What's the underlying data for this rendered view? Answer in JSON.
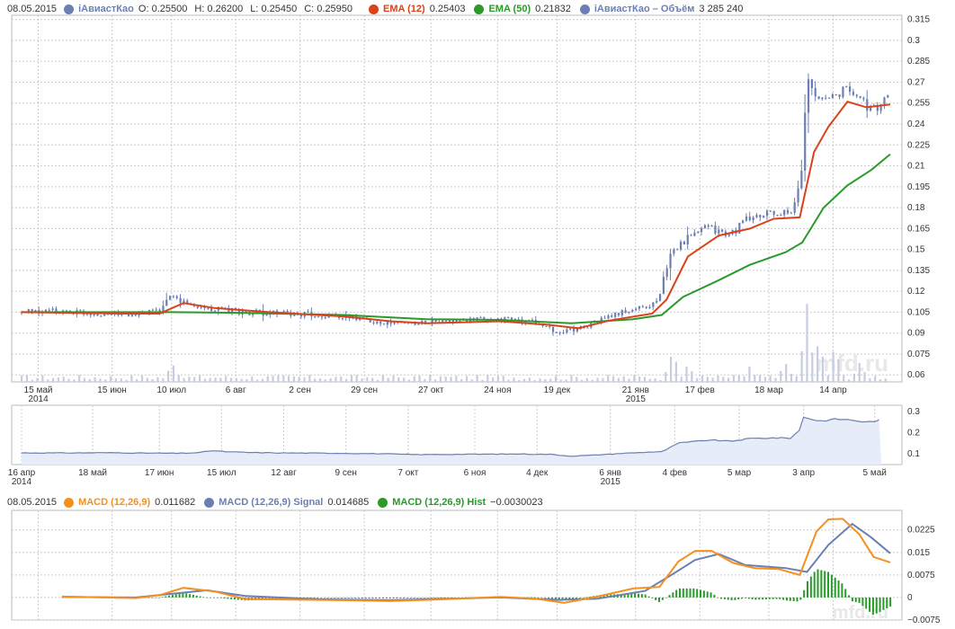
{
  "legend_main": {
    "date": "08.05.2015",
    "ticker": "iАвиастКао",
    "o_label": "O:",
    "o_value": "0.25500",
    "h_label": "H:",
    "h_value": "0.26200",
    "l_label": "L:",
    "l_value": "0.25450",
    "c_label": "C:",
    "c_value": "0.25950",
    "ema12_name": "EMA (12)",
    "ema12_value": "0.25403",
    "ema50_name": "EMA (50)",
    "ema50_value": "0.21832",
    "volume_name": "iАвиастКао – Объём",
    "volume_value": "3 285 240"
  },
  "legend_macd": {
    "date": "08.05.2015",
    "macd_name": "MACD (12,26,9)",
    "macd_value": "0.011682",
    "signal_name": "MACD (12,26,9) Signal",
    "signal_value": "0.014685",
    "hist_name": "MACD (12,26,9) Hist",
    "hist_value": "−0.0030023"
  },
  "colors": {
    "candle": "#6b7fb3",
    "ema12": "#d9431c",
    "ema50": "#2a9a2a",
    "volume": "#c7cde0",
    "macd": "#f5901e",
    "signal": "#6b7fb3",
    "hist": "#2a9a2a",
    "nav_line": "#6b7fb3",
    "nav_fill": "#e6edf8",
    "grid": "#cccccc",
    "watermark": "#e8e8e8"
  },
  "watermark": "mfd.ru",
  "chart_data": [
    {
      "type": "candlestick",
      "series_names": [
        "iАвиастКао",
        "EMA (12)",
        "EMA (50)",
        "iАвиастКао – Объём"
      ],
      "x_ticks": [
        {
          "label": "15 май",
          "sub": "2014",
          "date": "2014-05-15"
        },
        {
          "label": "15 июн",
          "date": "2014-06-15"
        },
        {
          "label": "10 июл",
          "date": "2014-07-10"
        },
        {
          "label": "6 авг",
          "date": "2014-08-06"
        },
        {
          "label": "2 сен",
          "date": "2014-09-02"
        },
        {
          "label": "29 сен",
          "date": "2014-09-29"
        },
        {
          "label": "27 окт",
          "date": "2014-10-27"
        },
        {
          "label": "24 ноя",
          "date": "2014-11-24"
        },
        {
          "label": "19 дек",
          "date": "2014-12-19"
        },
        {
          "label": "21 янв",
          "sub": "2015",
          "date": "2015-01-21"
        },
        {
          "label": "17 фев",
          "date": "2015-02-17"
        },
        {
          "label": "18 мар",
          "date": "2015-03-18"
        },
        {
          "label": "14 апр",
          "date": "2015-04-14"
        }
      ],
      "y_ticks": [
        0.06,
        0.075,
        0.09,
        0.105,
        0.12,
        0.135,
        0.15,
        0.165,
        0.18,
        0.195,
        0.21,
        0.225,
        0.24,
        0.255,
        0.27,
        0.285,
        0.3,
        0.315
      ],
      "ylim": [
        0.055,
        0.318
      ],
      "price_close": [
        {
          "x": "2014-05-08",
          "y": 0.105
        },
        {
          "x": "2014-05-25",
          "y": 0.106
        },
        {
          "x": "2014-06-10",
          "y": 0.104
        },
        {
          "x": "2014-06-25",
          "y": 0.103
        },
        {
          "x": "2014-07-05",
          "y": 0.106
        },
        {
          "x": "2014-07-10",
          "y": 0.116
        },
        {
          "x": "2014-07-18",
          "y": 0.11
        },
        {
          "x": "2014-07-28",
          "y": 0.107
        },
        {
          "x": "2014-08-10",
          "y": 0.105
        },
        {
          "x": "2014-08-25",
          "y": 0.104
        },
        {
          "x": "2014-09-10",
          "y": 0.103
        },
        {
          "x": "2014-09-25",
          "y": 0.101
        },
        {
          "x": "2014-10-10",
          "y": 0.097
        },
        {
          "x": "2014-10-25",
          "y": 0.098
        },
        {
          "x": "2014-11-10",
          "y": 0.099
        },
        {
          "x": "2014-11-25",
          "y": 0.1
        },
        {
          "x": "2014-12-10",
          "y": 0.098
        },
        {
          "x": "2014-12-19",
          "y": 0.09
        },
        {
          "x": "2014-12-29",
          "y": 0.094
        },
        {
          "x": "2015-01-10",
          "y": 0.102
        },
        {
          "x": "2015-01-20",
          "y": 0.107
        },
        {
          "x": "2015-01-30",
          "y": 0.112
        },
        {
          "x": "2015-02-05",
          "y": 0.15
        },
        {
          "x": "2015-02-12",
          "y": 0.158
        },
        {
          "x": "2015-02-20",
          "y": 0.166
        },
        {
          "x": "2015-03-01",
          "y": 0.16
        },
        {
          "x": "2015-03-10",
          "y": 0.173
        },
        {
          "x": "2015-03-20",
          "y": 0.176
        },
        {
          "x": "2015-03-28",
          "y": 0.175
        },
        {
          "x": "2015-04-01",
          "y": 0.21
        },
        {
          "x": "2015-04-03",
          "y": 0.275
        },
        {
          "x": "2015-04-10",
          "y": 0.255
        },
        {
          "x": "2015-04-18",
          "y": 0.265
        },
        {
          "x": "2015-04-25",
          "y": 0.26
        },
        {
          "x": "2015-05-01",
          "y": 0.25
        },
        {
          "x": "2015-05-08",
          "y": 0.2595
        }
      ],
      "ema12": [
        {
          "x": "2014-05-08",
          "y": 0.105
        },
        {
          "x": "2014-06-20",
          "y": 0.104
        },
        {
          "x": "2014-07-05",
          "y": 0.104
        },
        {
          "x": "2014-07-15",
          "y": 0.1115
        },
        {
          "x": "2014-07-28",
          "y": 0.108
        },
        {
          "x": "2014-08-20",
          "y": 0.105
        },
        {
          "x": "2014-09-20",
          "y": 0.102
        },
        {
          "x": "2014-10-10",
          "y": 0.0985
        },
        {
          "x": "2014-10-25",
          "y": 0.097
        },
        {
          "x": "2014-11-25",
          "y": 0.0985
        },
        {
          "x": "2014-12-15",
          "y": 0.096
        },
        {
          "x": "2014-12-28",
          "y": 0.0935
        },
        {
          "x": "2015-01-10",
          "y": 0.099
        },
        {
          "x": "2015-01-28",
          "y": 0.104
        },
        {
          "x": "2015-02-03",
          "y": 0.114
        },
        {
          "x": "2015-02-12",
          "y": 0.145
        },
        {
          "x": "2015-02-25",
          "y": 0.16
        },
        {
          "x": "2015-03-10",
          "y": 0.165
        },
        {
          "x": "2015-03-20",
          "y": 0.172
        },
        {
          "x": "2015-03-31",
          "y": 0.173
        },
        {
          "x": "2015-04-06",
          "y": 0.22
        },
        {
          "x": "2015-04-12",
          "y": 0.238
        },
        {
          "x": "2015-04-20",
          "y": 0.256
        },
        {
          "x": "2015-04-28",
          "y": 0.252
        },
        {
          "x": "2015-05-08",
          "y": 0.254
        }
      ],
      "ema50": [
        {
          "x": "2014-05-08",
          "y": 0.105
        },
        {
          "x": "2014-07-10",
          "y": 0.105
        },
        {
          "x": "2014-08-10",
          "y": 0.1045
        },
        {
          "x": "2014-09-20",
          "y": 0.103
        },
        {
          "x": "2014-10-25",
          "y": 0.1
        },
        {
          "x": "2014-11-25",
          "y": 0.0995
        },
        {
          "x": "2014-12-25",
          "y": 0.097
        },
        {
          "x": "2015-01-20",
          "y": 0.1
        },
        {
          "x": "2015-02-01",
          "y": 0.103
        },
        {
          "x": "2015-02-10",
          "y": 0.116
        },
        {
          "x": "2015-02-25",
          "y": 0.128
        },
        {
          "x": "2015-03-10",
          "y": 0.139
        },
        {
          "x": "2015-03-25",
          "y": 0.148
        },
        {
          "x": "2015-04-01",
          "y": 0.155
        },
        {
          "x": "2015-04-10",
          "y": 0.18
        },
        {
          "x": "2015-04-20",
          "y": 0.196
        },
        {
          "x": "2015-04-30",
          "y": 0.207
        },
        {
          "x": "2015-05-08",
          "y": 0.21832
        }
      ],
      "volume_relative": [
        {
          "x": "2014-07-10",
          "v": 0.3
        },
        {
          "x": "2015-02-05",
          "v": 0.45
        },
        {
          "x": "2015-02-12",
          "v": 0.25
        },
        {
          "x": "2015-03-10",
          "v": 0.2
        },
        {
          "x": "2015-03-25",
          "v": 0.25
        },
        {
          "x": "2015-04-03",
          "v": 1.0
        },
        {
          "x": "2015-04-08",
          "v": 0.55
        },
        {
          "x": "2015-04-15",
          "v": 0.45
        },
        {
          "x": "2015-04-25",
          "v": 0.3
        }
      ]
    },
    {
      "type": "area",
      "x_ticks": [
        {
          "label": "16 апр",
          "sub": "2014",
          "date": "2014-04-16"
        },
        {
          "label": "18 май",
          "date": "2014-05-18"
        },
        {
          "label": "17 июн",
          "date": "2014-06-17"
        },
        {
          "label": "15 июл",
          "date": "2014-07-15"
        },
        {
          "label": "12 авг",
          "date": "2014-08-12"
        },
        {
          "label": "9 сен",
          "date": "2014-09-09"
        },
        {
          "label": "7 окт",
          "date": "2014-10-07"
        },
        {
          "label": "6 ноя",
          "date": "2014-11-06"
        },
        {
          "label": "4 дек",
          "date": "2014-12-04"
        },
        {
          "label": "6 янв",
          "sub": "2015",
          "date": "2015-01-06"
        },
        {
          "label": "4 фев",
          "date": "2015-02-04"
        },
        {
          "label": "5 мар",
          "date": "2015-03-05"
        },
        {
          "label": "3 апр",
          "date": "2015-04-03"
        },
        {
          "label": "5 май",
          "date": "2015-05-05"
        }
      ],
      "y_ticks": [
        0.1,
        0.2,
        0.3
      ],
      "ylim": [
        0.05,
        0.33
      ]
    },
    {
      "type": "line",
      "series_names": [
        "MACD (12,26,9)",
        "MACD (12,26,9) Signal",
        "MACD (12,26,9) Hist"
      ],
      "y_ticks": [
        -0.0075,
        0,
        0.0075,
        0.015,
        0.0225
      ],
      "y_tick_labels": [
        "−0.0075",
        "0",
        "0.0075",
        "0.015",
        "0.0225"
      ],
      "ylim": [
        -0.0075,
        0.029
      ],
      "macd": [
        {
          "x": "2014-05-25",
          "y": 0.0003
        },
        {
          "x": "2014-06-25",
          "y": -0.0002
        },
        {
          "x": "2014-07-05",
          "y": 0.0008
        },
        {
          "x": "2014-07-15",
          "y": 0.0032
        },
        {
          "x": "2014-07-28",
          "y": 0.002
        },
        {
          "x": "2014-08-10",
          "y": -0.0005
        },
        {
          "x": "2014-09-10",
          "y": -0.0008
        },
        {
          "x": "2014-10-10",
          "y": -0.0012
        },
        {
          "x": "2014-10-25",
          "y": -0.0008
        },
        {
          "x": "2014-11-25",
          "y": 0.0002
        },
        {
          "x": "2014-12-10",
          "y": -0.0004
        },
        {
          "x": "2014-12-22",
          "y": -0.0018
        },
        {
          "x": "2015-01-05",
          "y": 0.0003
        },
        {
          "x": "2015-01-20",
          "y": 0.003
        },
        {
          "x": "2015-01-31",
          "y": 0.0035
        },
        {
          "x": "2015-02-08",
          "y": 0.012
        },
        {
          "x": "2015-02-15",
          "y": 0.0155
        },
        {
          "x": "2015-02-22",
          "y": 0.0155
        },
        {
          "x": "2015-03-03",
          "y": 0.0115
        },
        {
          "x": "2015-03-12",
          "y": 0.0098
        },
        {
          "x": "2015-03-22",
          "y": 0.0095
        },
        {
          "x": "2015-03-31",
          "y": 0.0075
        },
        {
          "x": "2015-04-07",
          "y": 0.022
        },
        {
          "x": "2015-04-12",
          "y": 0.026
        },
        {
          "x": "2015-04-18",
          "y": 0.0262
        },
        {
          "x": "2015-04-25",
          "y": 0.021
        },
        {
          "x": "2015-05-01",
          "y": 0.0135
        },
        {
          "x": "2015-05-08",
          "y": 0.011682
        }
      ],
      "signal": [
        {
          "x": "2014-05-25",
          "y": 0.0002
        },
        {
          "x": "2014-06-25",
          "y": 0
        },
        {
          "x": "2014-07-10",
          "y": 0.0012
        },
        {
          "x": "2014-07-25",
          "y": 0.0024
        },
        {
          "x": "2014-08-10",
          "y": 0.0005
        },
        {
          "x": "2014-09-10",
          "y": -0.0006
        },
        {
          "x": "2014-10-10",
          "y": -0.0009
        },
        {
          "x": "2014-11-25",
          "y": 0
        },
        {
          "x": "2014-12-20",
          "y": -0.0008
        },
        {
          "x": "2015-01-05",
          "y": -0.0004
        },
        {
          "x": "2015-01-25",
          "y": 0.0022
        },
        {
          "x": "2015-02-05",
          "y": 0.0075
        },
        {
          "x": "2015-02-15",
          "y": 0.0125
        },
        {
          "x": "2015-02-25",
          "y": 0.0145
        },
        {
          "x": "2015-03-08",
          "y": 0.0108
        },
        {
          "x": "2015-03-25",
          "y": 0.0098
        },
        {
          "x": "2015-04-03",
          "y": 0.0085
        },
        {
          "x": "2015-04-12",
          "y": 0.0175
        },
        {
          "x": "2015-04-22",
          "y": 0.0245
        },
        {
          "x": "2015-04-30",
          "y": 0.02
        },
        {
          "x": "2015-05-08",
          "y": 0.014685
        }
      ]
    }
  ]
}
